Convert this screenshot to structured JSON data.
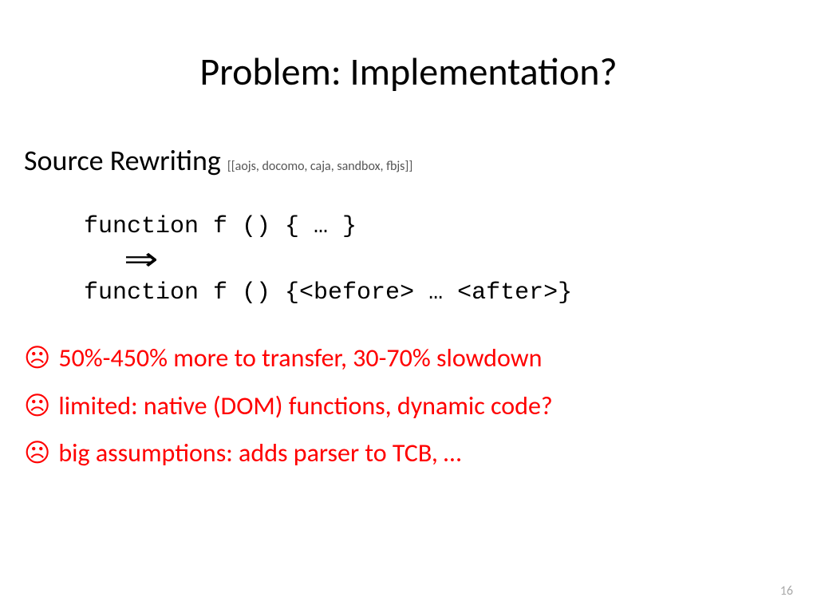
{
  "title": "Problem: Implementation?",
  "subheading": "Source Rewriting",
  "citation": "[[aojs, docomo, caja, sandbox, fbjs]]",
  "code": {
    "line1": "function f () { … }",
    "arrow": "⇒",
    "line2": "function f () {<before> … <after>}"
  },
  "cons": {
    "icon": "☹",
    "item1": "50%-450% more to transfer, 30-70% slowdown",
    "item2": " limited: native (DOM) functions, dynamic code?",
    "item3": " big assumptions: adds parser to TCB, …"
  },
  "pageNumber": "16",
  "colors": {
    "con_text": "#ff0000"
  }
}
